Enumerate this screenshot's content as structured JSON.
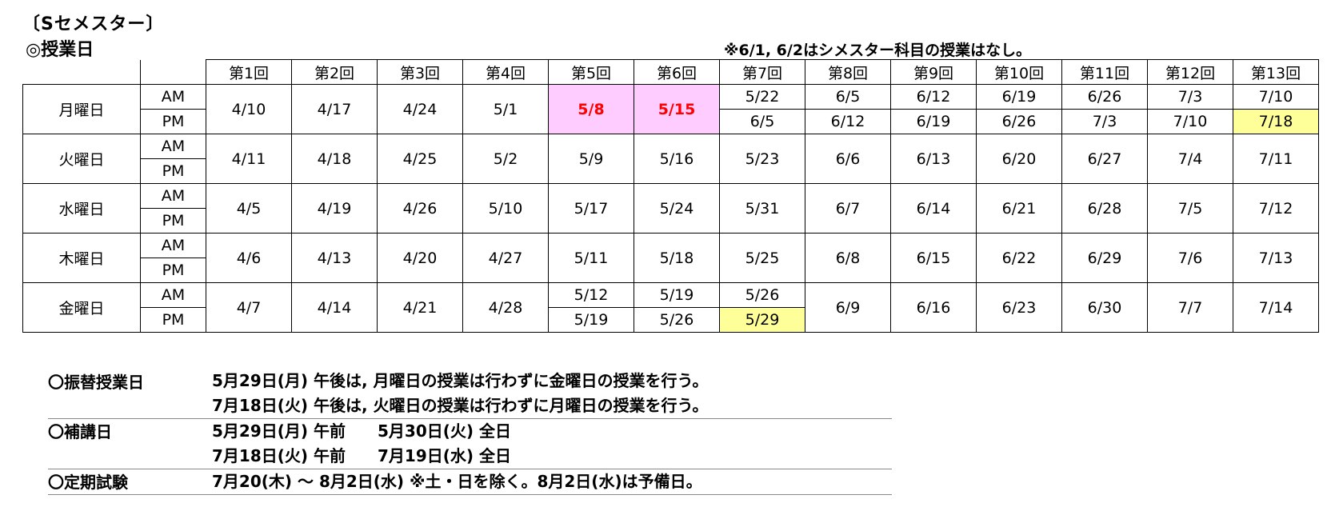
{
  "heading": "〔Sセメスター〕",
  "subheading": "◎授業日",
  "note": "※6/1, 6/2はシメスター科目の授業はなし。",
  "columns": [
    "第1回",
    "第2回",
    "第3回",
    "第4回",
    "第5回",
    "第6回",
    "第7回",
    "第8回",
    "第9回",
    "第10回",
    "第11回",
    "第12回",
    "第13回"
  ],
  "am_label": "AM",
  "pm_label": "PM",
  "colors": {
    "pink_bg": "#ffccff",
    "pink_text": "#ff0000",
    "yellow_bg": "#ffff99"
  },
  "days": {
    "mon": {
      "name": "月曜日",
      "shared": [
        "4/10",
        "4/17",
        "4/24",
        "5/1",
        "5/8",
        "5/15"
      ],
      "am": [
        "5/22",
        "6/5",
        "6/12",
        "6/19",
        "6/26",
        "7/3",
        "7/10"
      ],
      "pm": [
        "6/5",
        "6/12",
        "6/19",
        "6/26",
        "7/3",
        "7/10",
        "7/18"
      ]
    },
    "tue": {
      "name": "火曜日",
      "shared": [
        "4/11",
        "4/18",
        "4/25",
        "5/2",
        "5/9",
        "5/16",
        "5/23",
        "6/6",
        "6/13",
        "6/20",
        "6/27",
        "7/4",
        "7/11"
      ]
    },
    "wed": {
      "name": "水曜日",
      "shared": [
        "4/5",
        "4/19",
        "4/26",
        "5/10",
        "5/17",
        "5/24",
        "5/31",
        "6/7",
        "6/14",
        "6/21",
        "6/28",
        "7/5",
        "7/12"
      ]
    },
    "thu": {
      "name": "木曜日",
      "shared": [
        "4/6",
        "4/13",
        "4/20",
        "4/27",
        "5/11",
        "5/18",
        "5/25",
        "6/8",
        "6/15",
        "6/22",
        "6/29",
        "7/6",
        "7/13"
      ]
    },
    "fri": {
      "name": "金曜日",
      "shared_a": [
        "4/7",
        "4/14",
        "4/21",
        "4/28"
      ],
      "am": [
        "5/12",
        "5/19",
        "5/26"
      ],
      "pm": [
        "5/19",
        "5/26",
        "5/29"
      ],
      "shared_b": [
        "6/9",
        "6/16",
        "6/23",
        "6/30",
        "7/7",
        "7/14"
      ]
    }
  },
  "notes": {
    "makeup_day": {
      "label": "〇振替授業日",
      "lines": [
        "5月29日(月) 午後は, 月曜日の授業は行わずに金曜日の授業を行う。",
        "7月18日(火) 午後は, 火曜日の授業は行わずに月曜日の授業を行う。"
      ]
    },
    "supplementary": {
      "label": "〇補講日",
      "lines": [
        "5月29日(月) 午前　　5月30日(火) 全日",
        "7月18日(火) 午前　　7月19日(水) 全日"
      ]
    },
    "exam": {
      "label": "〇定期試験",
      "lines": [
        "7月20(木) ～ 8月2日(水)  ※土・日を除く。8月2日(水)は予備日。"
      ]
    }
  }
}
